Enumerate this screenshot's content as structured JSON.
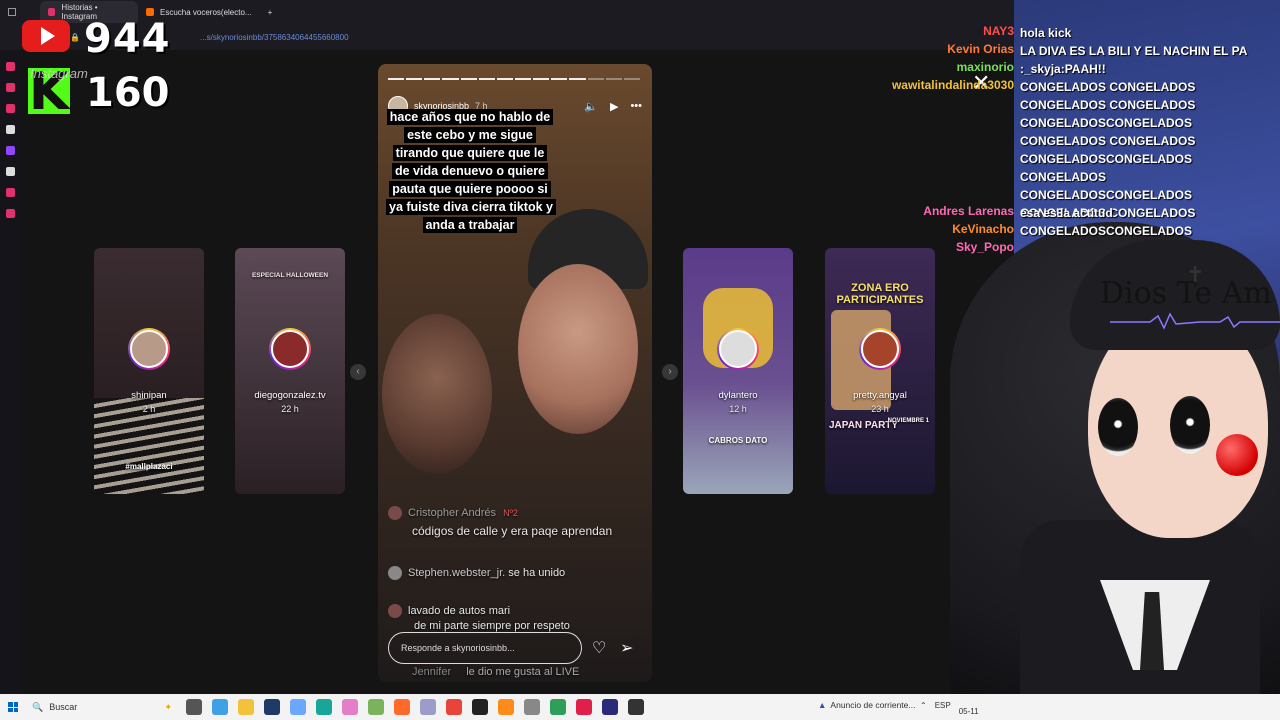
{
  "browser": {
    "tabs": [
      {
        "label": "Historias • Instagram",
        "color": "#e1306c"
      },
      {
        "label": "Escucha voceros(electo...",
        "color": "#ff6a00"
      }
    ],
    "new_tab": "+",
    "url": "...s/skynoriosinbb/3758634064455660800"
  },
  "counters": {
    "youtube_count": "944",
    "kick_letter": "K",
    "kick_count": "160",
    "instagram_label": "Instagram"
  },
  "story": {
    "username": "skynoriosinbb",
    "time": "7 h",
    "caption": "hace años que no hablo de este cebo y me sigue tirando que quiere que le de vida denuevo o quiere pauta que quiere poooo si ya fuiste diva cierra tiktok y anda a trabajar",
    "comments": [
      {
        "user": "Cristopher Andrés",
        "badge": "Nº2",
        "text": "códigos de calle y era paqe aprendan"
      },
      {
        "user": "Stephen.webster_jr.",
        "text": "se ha unido"
      },
      {
        "user": "lavado de autos mari",
        "text": "de mi parte  siempre por respeto"
      },
      {
        "user": "Jennifer",
        "text": "le dio me gusta al LIVE"
      }
    ],
    "reply_placeholder": "Responde a skynoriosinbb...",
    "progress_total": 14,
    "progress_done": 11
  },
  "side_stories": [
    {
      "user": "shinipan",
      "time": "2 h",
      "extra": "#mallplazaci",
      "bg": [
        "#2a1f24",
        "#5a3c3c"
      ]
    },
    {
      "user": "diegogonzalez.tv",
      "time": "22 h",
      "extra": "ESPECIAL HALLOWEEN",
      "bg": [
        "#5c4a56",
        "#2a2024"
      ]
    },
    {
      "user": "dylantero",
      "time": "12 h",
      "extra": "CABROS DATO",
      "bg": [
        "#5a3b8a",
        "#9aa6b8"
      ]
    },
    {
      "user": "pretty.angyal",
      "time": "23 h",
      "extra": "ZONA ERO PARTICIPANTES",
      "extra2": "JAPAN PARTY",
      "extra3": "NOVIEMBRE 1",
      "bg": [
        "#3e2a55",
        "#1c1730"
      ]
    }
  ],
  "stream_chat": [
    {
      "name": "",
      "text": "",
      "color": "#ff4e4e"
    },
    {
      "name": "NAY3",
      "text": "hola kick",
      "color": "#ff4e4e"
    },
    {
      "name": "Kevin Orias",
      "text": "LA DIVA ES LA BILI Y EL NACHIN EL PA",
      "color": "#ff7a3a"
    },
    {
      "name": "maxinorio",
      "text": ":_skyja:PAAH!!",
      "color": "#7dde5b"
    },
    {
      "name": "wawitalindalinda3030",
      "text": "CONGELADOS CONGELADOS CONGELADOS CONGELADOS CONGELADOSCONGELADOS CONGELADOS CONGELADOS CONGELADOSCONGELADOS CONGELADOS CONGELADOSCONGELADOS CONGELADOS CONGELADOS CONGELADOSCONGELADOS",
      "color": "#f0c23a"
    },
    {
      "name": "Andres Larenas",
      "text": "esa es la actitud",
      "color": "#ff69b4"
    },
    {
      "name": "KeVinacho",
      "text": "",
      "color": "#ff8c2a"
    },
    {
      "name": "Sky_Popo",
      "text": "",
      "color": "#ff69b4"
    }
  ],
  "vtuber": {
    "overlay_text": "Dios Te Am"
  },
  "taskbar": {
    "search_label": "Buscar",
    "notification": "Anuncio de corriente...",
    "lang": "ESP",
    "date": "05-11"
  }
}
